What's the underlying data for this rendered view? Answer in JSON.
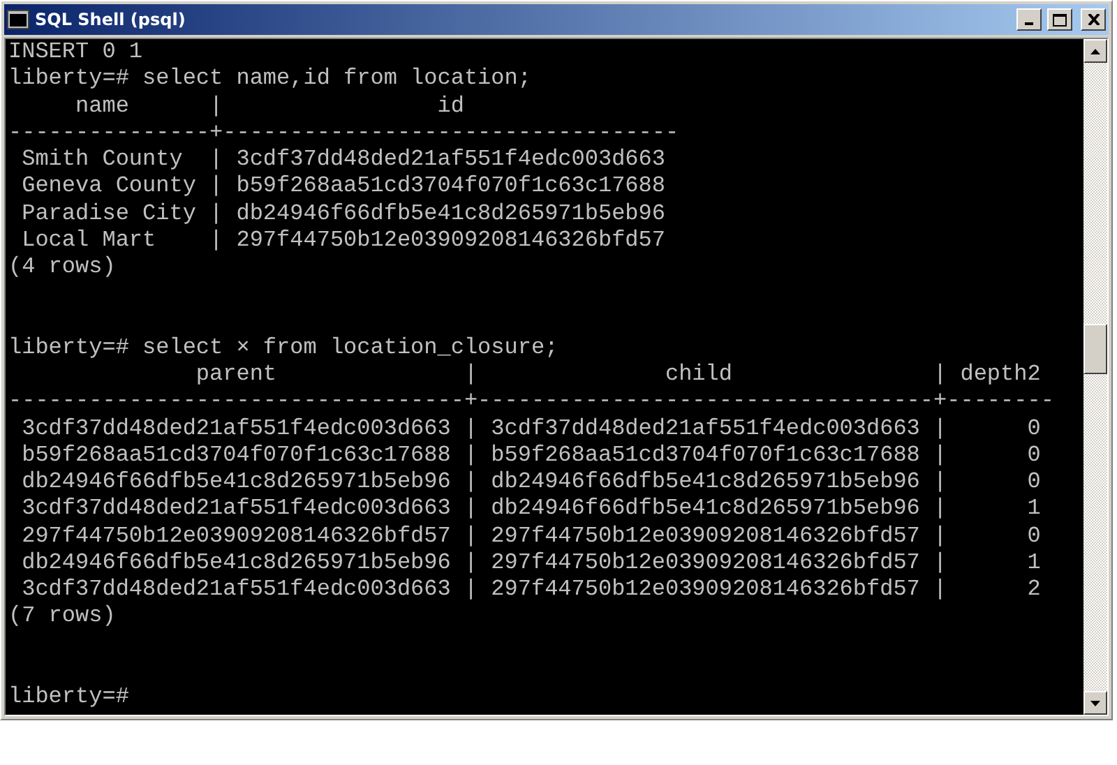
{
  "window": {
    "title": "SQL Shell (psql)"
  },
  "console": {
    "blocks": [
      [
        "INSERT 0 1",
        "liberty=# select name,id from location;",
        "     name      |                id",
        "---------------+----------------------------------",
        " Smith County  | 3cdf37dd48ded21af551f4edc003d663",
        " Geneva County | b59f268aa51cd3704f070f1c63c17688",
        " Paradise City | db24946f66dfb5e41c8d265971b5eb96",
        " Local Mart    | 297f44750b12e03909208146326bfd57",
        "(4 rows)"
      ],
      [
        "liberty=# select × from location_closure;",
        "              parent              |              child               | depth2",
        "----------------------------------+----------------------------------+--------",
        " 3cdf37dd48ded21af551f4edc003d663 | 3cdf37dd48ded21af551f4edc003d663 |      0",
        " b59f268aa51cd3704f070f1c63c17688 | b59f268aa51cd3704f070f1c63c17688 |      0",
        " db24946f66dfb5e41c8d265971b5eb96 | db24946f66dfb5e41c8d265971b5eb96 |      0",
        " 3cdf37dd48ded21af551f4edc003d663 | db24946f66dfb5e41c8d265971b5eb96 |      1",
        " 297f44750b12e03909208146326bfd57 | 297f44750b12e03909208146326bfd57 |      0",
        " db24946f66dfb5e41c8d265971b5eb96 | 297f44750b12e03909208146326bfd57 |      1",
        " 3cdf37dd48ded21af551f4edc003d663 | 297f44750b12e03909208146326bfd57 |      2",
        "(7 rows)"
      ],
      [
        "liberty=#"
      ]
    ]
  }
}
